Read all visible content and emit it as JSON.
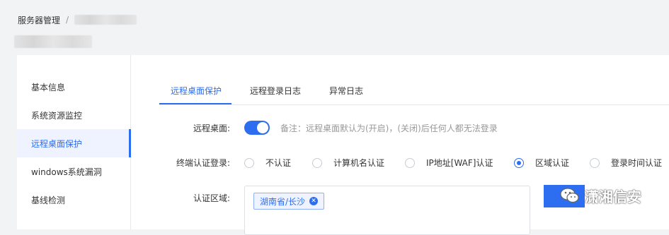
{
  "breadcrumb": {
    "root": "服务器管理",
    "separator": "/"
  },
  "sidebar": {
    "items": [
      {
        "label": "基本信息"
      },
      {
        "label": "系统资源监控"
      },
      {
        "label": "远程桌面保护"
      },
      {
        "label": "windows系统漏洞"
      },
      {
        "label": "基线检测"
      }
    ]
  },
  "tabs": [
    {
      "label": "远程桌面保护"
    },
    {
      "label": "远程登录日志"
    },
    {
      "label": "异常日志"
    }
  ],
  "form": {
    "remote_desktop": {
      "label": "远程桌面:",
      "enabled": true,
      "note": "备注：远程桌面默认为(开启)，(关闭)后任何人都无法登录"
    },
    "terminal_auth": {
      "label": "终端认证登录:",
      "options": [
        {
          "label": "不认证",
          "checked": false
        },
        {
          "label": "计算机名认证",
          "checked": false
        },
        {
          "label": "IP地址[WAF]认证",
          "checked": false
        },
        {
          "label": "区域认证",
          "checked": true
        },
        {
          "label": "登录时间认证",
          "checked": false
        }
      ]
    },
    "auth_region": {
      "label": "认证区域:",
      "tags": [
        "湖南省/长沙"
      ]
    }
  },
  "watermark": {
    "text": "潇湘信安",
    "icon": "wechat-icon"
  },
  "colors": {
    "accent": "#2d6df0",
    "active_bg": "#eef3ff",
    "page_bg": "#f2f3f5"
  }
}
